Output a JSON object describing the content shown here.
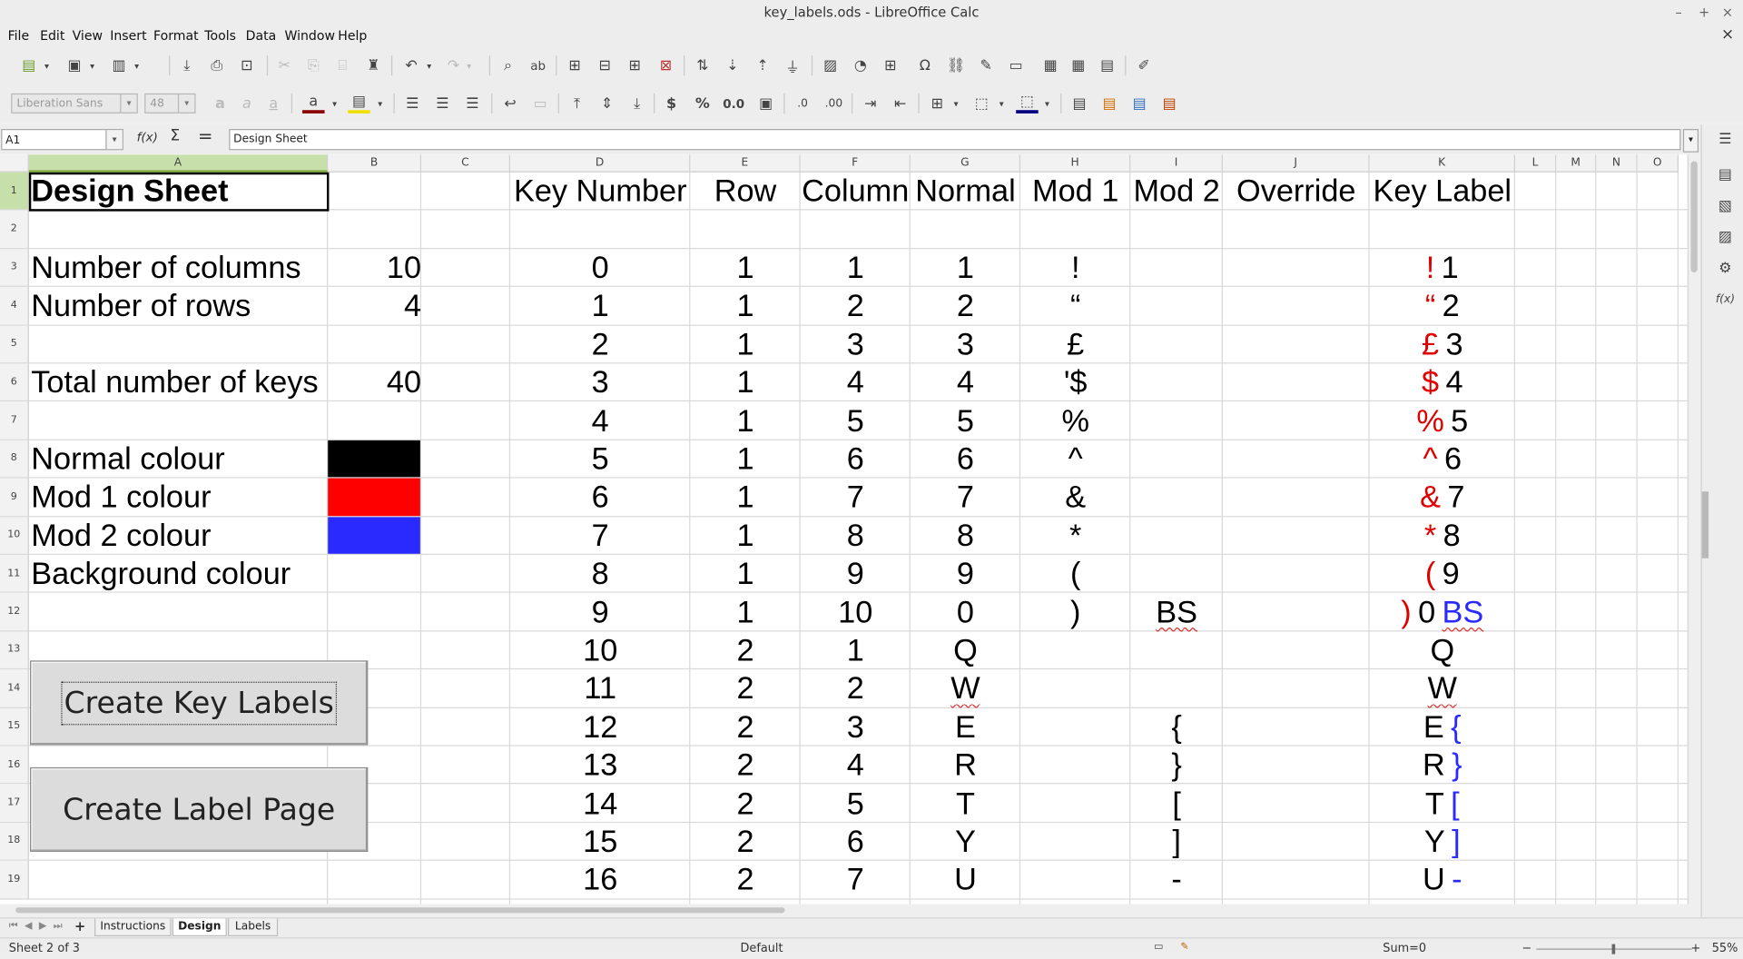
{
  "window": {
    "title": "key_labels.ods - LibreOffice Calc",
    "controls": [
      "–",
      "+",
      "×"
    ],
    "close_doc": "×"
  },
  "menu": [
    "File",
    "Edit",
    "View",
    "Insert",
    "Format",
    "Tools",
    "Data",
    "Window",
    "Help"
  ],
  "toolbar2": {
    "font_name": "Liberation Sans",
    "font_size": "48"
  },
  "formula_bar": {
    "cell_ref": "A1",
    "fx_label": "f(x)",
    "sum_label": "Σ",
    "equals_label": "=",
    "content": "Design Sheet"
  },
  "columns": [
    "A",
    "B",
    "C",
    "D",
    "E",
    "F",
    "G",
    "H",
    "I",
    "J",
    "K",
    "L",
    "M",
    "N",
    "O"
  ],
  "rows": [
    "1",
    "2",
    "3",
    "4",
    "5",
    "6",
    "7",
    "8",
    "9",
    "10",
    "11",
    "12",
    "13",
    "14",
    "15",
    "16",
    "17",
    "18",
    "19"
  ],
  "sheet_left": {
    "title": "Design Sheet",
    "num_columns_label": "Number of columns",
    "num_columns_value": "10",
    "num_rows_label": "Number of rows",
    "num_rows_value": "4",
    "total_keys_label": "Total number of keys",
    "total_keys_value": "40",
    "normal_colour_label": "Normal colour",
    "mod1_colour_label": "Mod 1 colour",
    "mod2_colour_label": "Mod 2 colour",
    "background_colour_label": "Background colour",
    "normal_colour": "#000000",
    "mod1_colour": "#ff0000",
    "mod2_colour": "#2a2aff",
    "create_key_labels_button": "Create Key Labels",
    "create_label_page_button": "Create Label Page"
  },
  "table_headers": [
    "Key Number",
    "Row",
    "Column",
    "Normal",
    "Mod 1",
    "Mod 2",
    "Override",
    "Key Label"
  ],
  "table_rows": [
    {
      "key": "0",
      "row": "1",
      "col": "1",
      "normal": "1",
      "mod1": "!",
      "mod2": "",
      "override": "",
      "label_mod1": "!",
      "label_normal": "1",
      "label_mod2": ""
    },
    {
      "key": "1",
      "row": "1",
      "col": "2",
      "normal": "2",
      "mod1": "“",
      "mod2": "",
      "override": "",
      "label_mod1": "“",
      "label_normal": "2",
      "label_mod2": ""
    },
    {
      "key": "2",
      "row": "1",
      "col": "3",
      "normal": "3",
      "mod1": "£",
      "mod2": "",
      "override": "",
      "label_mod1": "£",
      "label_normal": "3",
      "label_mod2": ""
    },
    {
      "key": "3",
      "row": "1",
      "col": "4",
      "normal": "4",
      "mod1": "'$",
      "mod2": "",
      "override": "",
      "label_mod1": "$",
      "label_normal": "4",
      "label_mod2": ""
    },
    {
      "key": "4",
      "row": "1",
      "col": "5",
      "normal": "5",
      "mod1": "%",
      "mod2": "",
      "override": "",
      "label_mod1": "%",
      "label_normal": "5",
      "label_mod2": ""
    },
    {
      "key": "5",
      "row": "1",
      "col": "6",
      "normal": "6",
      "mod1": "^",
      "mod2": "",
      "override": "",
      "label_mod1": "^",
      "label_normal": "6",
      "label_mod2": ""
    },
    {
      "key": "6",
      "row": "1",
      "col": "7",
      "normal": "7",
      "mod1": "&",
      "mod2": "",
      "override": "",
      "label_mod1": "&",
      "label_normal": "7",
      "label_mod2": ""
    },
    {
      "key": "7",
      "row": "1",
      "col": "8",
      "normal": "8",
      "mod1": "*",
      "mod2": "",
      "override": "",
      "label_mod1": "*",
      "label_normal": "8",
      "label_mod2": ""
    },
    {
      "key": "8",
      "row": "1",
      "col": "9",
      "normal": "9",
      "mod1": "(",
      "mod2": "",
      "override": "",
      "label_mod1": "(",
      "label_normal": "9",
      "label_mod2": ""
    },
    {
      "key": "9",
      "row": "1",
      "col": "10",
      "normal": "0",
      "mod1": ")",
      "mod2": "BS",
      "override": "",
      "label_mod1": ")",
      "label_normal": "0",
      "label_mod2": "BS"
    },
    {
      "key": "10",
      "row": "2",
      "col": "1",
      "normal": "Q",
      "mod1": "",
      "mod2": "",
      "override": "",
      "label_mod1": "",
      "label_normal": "Q",
      "label_mod2": ""
    },
    {
      "key": "11",
      "row": "2",
      "col": "2",
      "normal": "W",
      "mod1": "",
      "mod2": "",
      "override": "",
      "label_mod1": "",
      "label_normal": "W",
      "label_mod2": ""
    },
    {
      "key": "12",
      "row": "2",
      "col": "3",
      "normal": "E",
      "mod1": "",
      "mod2": "{",
      "override": "",
      "label_mod1": "",
      "label_normal": "E",
      "label_mod2": "{"
    },
    {
      "key": "13",
      "row": "2",
      "col": "4",
      "normal": "R",
      "mod1": "",
      "mod2": "}",
      "override": "",
      "label_mod1": "",
      "label_normal": "R",
      "label_mod2": "}"
    },
    {
      "key": "14",
      "row": "2",
      "col": "5",
      "normal": "T",
      "mod1": "",
      "mod2": "[",
      "override": "",
      "label_mod1": "",
      "label_normal": "T",
      "label_mod2": "["
    },
    {
      "key": "15",
      "row": "2",
      "col": "6",
      "normal": "Y",
      "mod1": "",
      "mod2": "]",
      "override": "",
      "label_mod1": "",
      "label_normal": "Y",
      "label_mod2": "]"
    },
    {
      "key": "16",
      "row": "2",
      "col": "7",
      "normal": "U",
      "mod1": "",
      "mod2": "-",
      "override": "",
      "label_mod1": "",
      "label_normal": "U",
      "label_mod2": "-"
    }
  ],
  "sheet_tabs": [
    "Instructions",
    "Design",
    "Labels"
  ],
  "active_tab": "Design",
  "status": {
    "sheet": "Sheet 2 of 3",
    "page_style": "Default",
    "sum": "Sum=0",
    "zoom": "55%"
  }
}
